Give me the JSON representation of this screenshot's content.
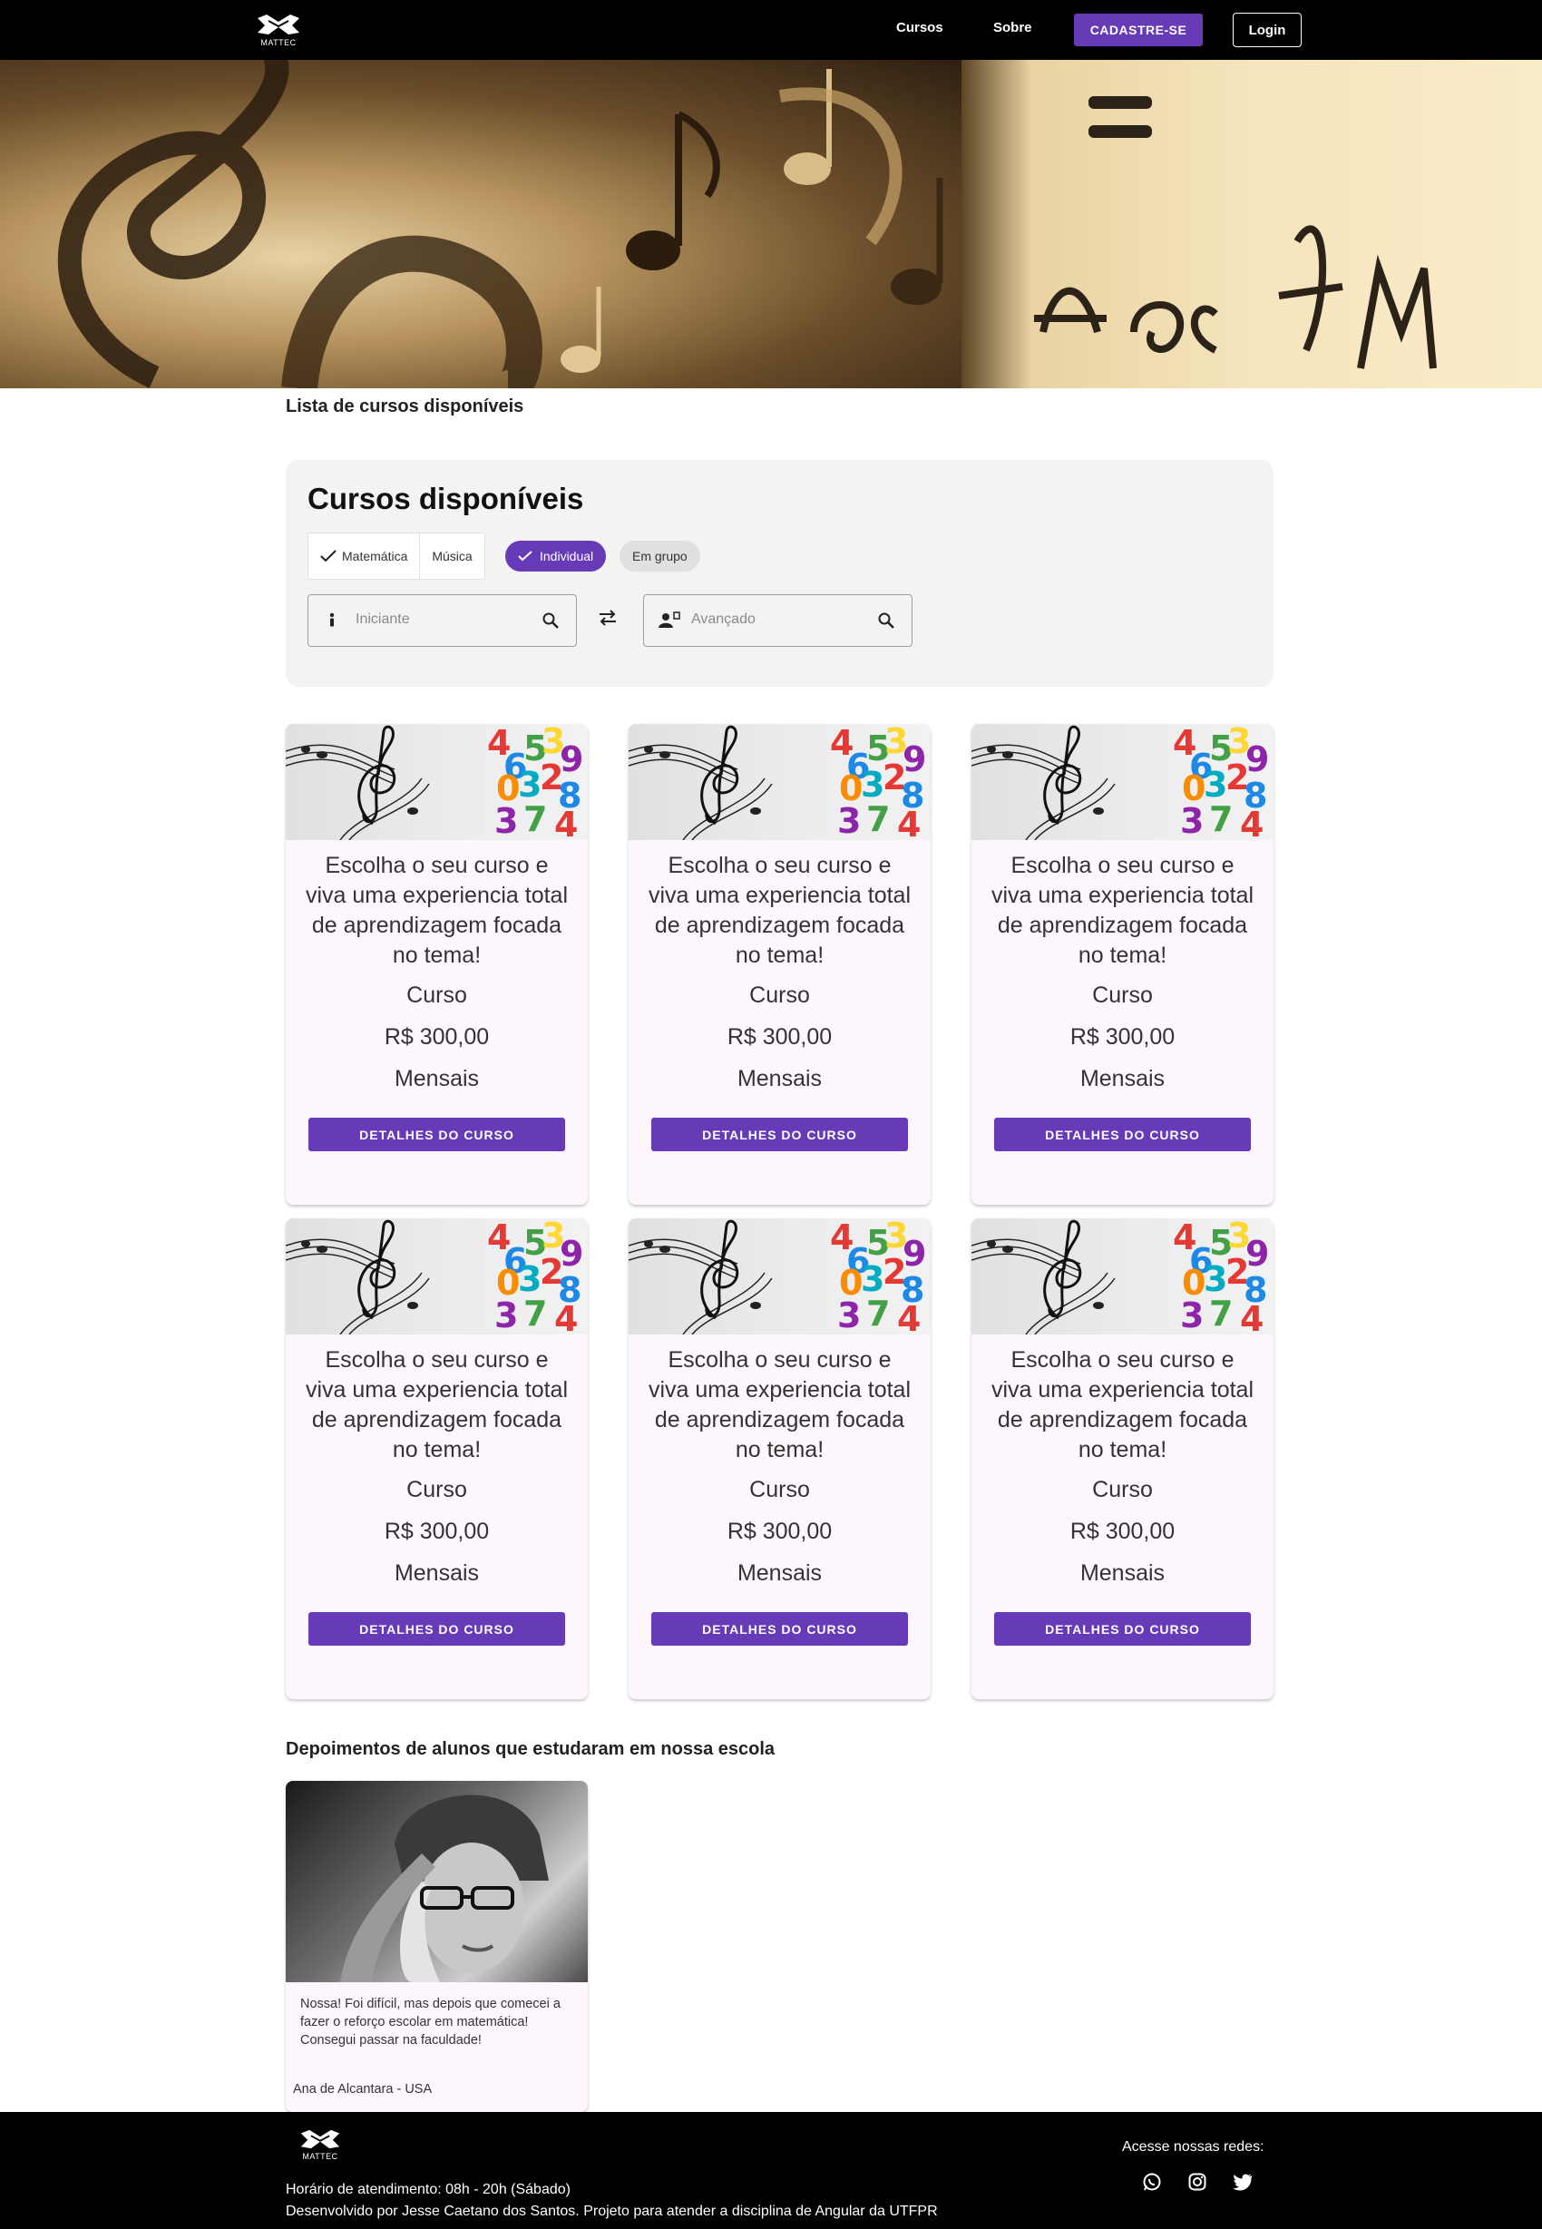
{
  "brand": {
    "name": "MATTEC"
  },
  "nav": {
    "links": [
      "Cursos",
      "Sobre"
    ],
    "signup_label": "CADASTRE-SE",
    "login_label": "Login"
  },
  "main": {
    "list_label": "Lista de cursos disponíveis",
    "panel_title": "Cursos disponíveis",
    "toggles": [
      {
        "label": "Matemática",
        "selected": true
      },
      {
        "label": "Música",
        "selected": false
      }
    ],
    "chips": [
      {
        "label": "Individual",
        "selected": true
      },
      {
        "label": "Em grupo",
        "selected": false
      }
    ],
    "level_from": {
      "placeholder": "Iniciante",
      "value": ""
    },
    "level_to": {
      "placeholder": "Avançado",
      "value": ""
    }
  },
  "courses": [
    {
      "description": "Escolha o seu curso e viva uma experiencia total de aprendizagem focada no tema!",
      "type": "Curso",
      "price": "R$ 300,00",
      "period": "Mensais",
      "button": "DETALHES DO CURSO"
    },
    {
      "description": "Escolha o seu curso e viva uma experiencia total de aprendizagem focada no tema!",
      "type": "Curso",
      "price": "R$ 300,00",
      "period": "Mensais",
      "button": "DETALHES DO CURSO"
    },
    {
      "description": "Escolha o seu curso e viva uma experiencia total de aprendizagem focada no tema!",
      "type": "Curso",
      "price": "R$ 300,00",
      "period": "Mensais",
      "button": "DETALHES DO CURSO"
    },
    {
      "description": "Escolha o seu curso e viva uma experiencia total de aprendizagem focada no tema!",
      "type": "Curso",
      "price": "R$ 300,00",
      "period": "Mensais",
      "button": "DETALHES DO CURSO"
    },
    {
      "description": "Escolha o seu curso e viva uma experiencia total de aprendizagem focada no tema!",
      "type": "Curso",
      "price": "R$ 300,00",
      "period": "Mensais",
      "button": "DETALHES DO CURSO"
    },
    {
      "description": "Escolha o seu curso e viva uma experiencia total de aprendizagem focada no tema!",
      "type": "Curso",
      "price": "R$ 300,00",
      "period": "Mensais",
      "button": "DETALHES DO CURSO"
    }
  ],
  "course_image_glyphs": [
    "4",
    "6",
    "5",
    "3",
    "9",
    "0",
    "3",
    "2",
    "8",
    "3",
    "7",
    "4"
  ],
  "testimonials_label": "Depoimentos de alunos que estudaram em nossa escola",
  "testimonials": [
    {
      "text": "Nossa! Foi difícil, mas depois que comecei a fazer o reforço escolar em matemática! Consegui passar na faculdade!",
      "author": "Ana de Alcantara - USA"
    }
  ],
  "footer": {
    "hours": "Horário de atendimento: 08h - 20h (Sábado)",
    "developer": "Desenvolvido por Jesse Caetano dos Santos. Projeto para atender a disciplina de Angular da UTFPR",
    "social_label": "Acesse nossas redes:",
    "social_icons": [
      "whatsapp-icon",
      "instagram-icon",
      "twitter-icon"
    ]
  },
  "colors": {
    "accent": "#673ab7",
    "nav_bg": "#000000",
    "card_bg": "#fdf6fd",
    "panel_bg": "#f3f3f3"
  }
}
